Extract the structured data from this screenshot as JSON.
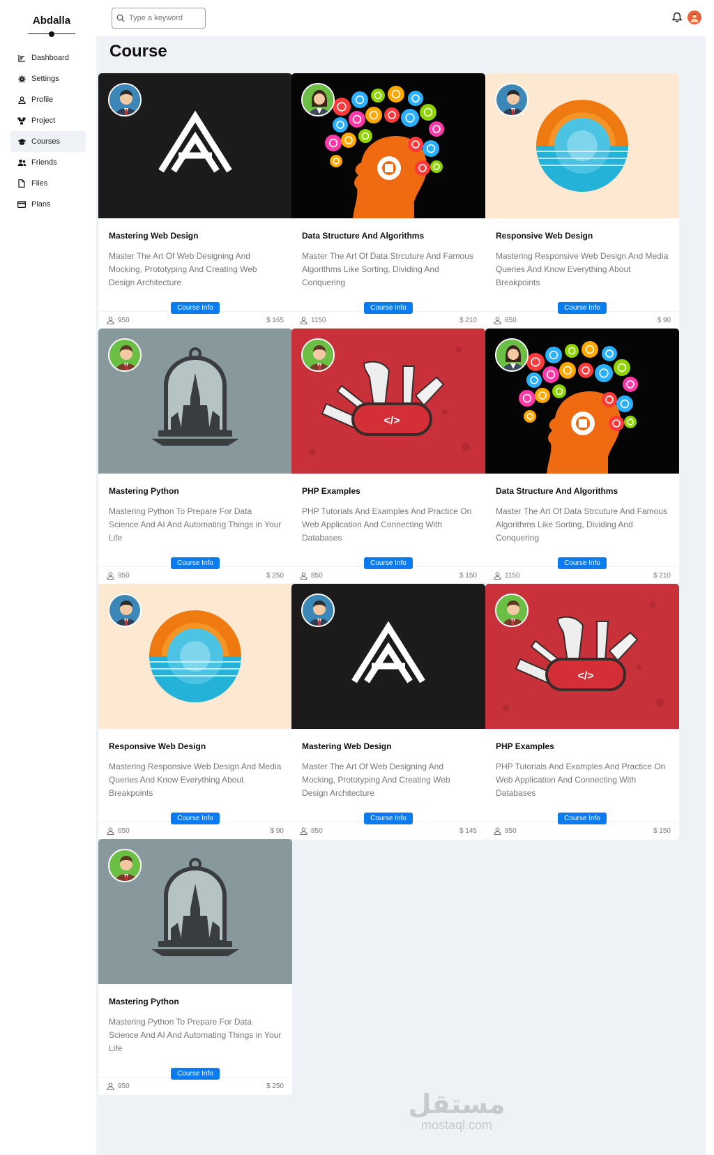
{
  "brand": "Abdalla",
  "sidebar": {
    "items": [
      {
        "label": "Dashboard",
        "icon": "chart-icon"
      },
      {
        "label": "Settings",
        "icon": "gear-icon"
      },
      {
        "label": "Profile",
        "icon": "user-icon"
      },
      {
        "label": "Project",
        "icon": "project-icon"
      },
      {
        "label": "Courses",
        "icon": "graduation-cap-icon",
        "active": true
      },
      {
        "label": "Friends",
        "icon": "users-icon"
      },
      {
        "label": "Files",
        "icon": "file-icon"
      },
      {
        "label": "Plans",
        "icon": "credit-card-icon"
      }
    ]
  },
  "header": {
    "search_placeholder": "Type a keyword",
    "icons": [
      "bell-icon",
      "user-avatar-icon"
    ]
  },
  "page": {
    "title": "Course"
  },
  "colors": {
    "accent": "#0a7cef",
    "background": "#eef1f6",
    "card": "#ffffff",
    "muted_text": "#777777"
  },
  "courses": [
    {
      "title": "Mastering Web Design",
      "description": "Master The Art Of Web Designing And Mocking, Prototyping And Creating Web Design Architecture",
      "button": "Course Info",
      "students": "950",
      "price": "$ 165",
      "image": "mountain-logo",
      "avatar": "blue-avatar"
    },
    {
      "title": "Data Structure And Algorithms",
      "description": "Master The Art Of Data Strcuture And Famous Algorithms Like Sorting, Dividing And Conquering",
      "button": "Course Info",
      "students": "1150",
      "price": "$ 210",
      "image": "science-head",
      "avatar": "green-female-avatar"
    },
    {
      "title": "Responsive Web Design",
      "description": "Mastering Responsive Web Design And Media Queries And Know Everything About Breakpoints",
      "button": "Course Info",
      "students": "650",
      "price": "$ 90",
      "image": "sunset-circle",
      "avatar": "blue-avatar"
    },
    {
      "title": "Mastering Python",
      "description": "Mastering Python To Prepare For Data Science And AI And Automating Things in Your Life",
      "button": "Course Info",
      "students": "950",
      "price": "$ 250",
      "image": "bell-jar-tower",
      "avatar": "green-avatar"
    },
    {
      "title": "PHP Examples",
      "description": "PHP Tutorials And Examples And Practice On Web Application And Connecting With Databases",
      "button": "Course Info",
      "students": "850",
      "price": "$ 150",
      "image": "swiss-knife-code",
      "avatar": "green-avatar"
    },
    {
      "title": "Data Structure And Algorithms",
      "description": "Master The Art Of Data Strcuture And Famous Algorithms Like Sorting, Dividing And Conquering",
      "button": "Course Info",
      "students": "1150",
      "price": "$ 210",
      "image": "science-head",
      "avatar": "green-female-avatar"
    },
    {
      "title": "Responsive Web Design",
      "description": "Mastering Responsive Web Design And Media Queries And Know Everything About Breakpoints",
      "button": "Course Info",
      "students": "650",
      "price": "$ 90",
      "image": "sunset-circle",
      "avatar": "blue-avatar"
    },
    {
      "title": "Mastering Web Design",
      "description": "Master The Art Of Web Designing And Mocking, Prototyping And Creating Web Design Architecture",
      "button": "Course Info",
      "students": "850",
      "price": "$ 145",
      "image": "mountain-logo",
      "avatar": "blue-avatar"
    },
    {
      "title": "PHP Examples",
      "description": "PHP Tutorials And Examples And Practice On Web Application And Connecting With Databases",
      "button": "Course Info",
      "students": "850",
      "price": "$ 150",
      "image": "swiss-knife-code",
      "avatar": "green-avatar"
    },
    {
      "title": "Mastering Python",
      "description": "Mastering Python To Prepare For Data Science And AI And Automating Things in Your Life",
      "button": "Course Info",
      "students": "950",
      "price": "$ 250",
      "image": "bell-jar-tower",
      "avatar": "green-avatar"
    }
  ],
  "watermark": {
    "arabic": "مستقل",
    "latin": "mostaql.com"
  }
}
